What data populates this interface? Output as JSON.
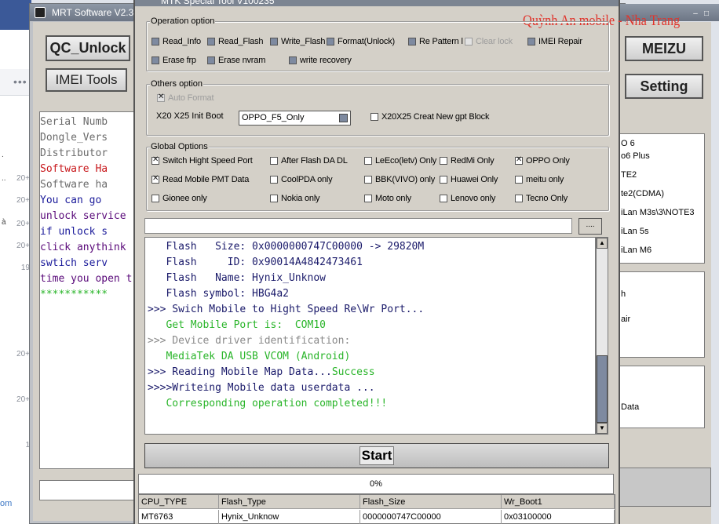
{
  "bg": {
    "gutter_numbers": [
      "20+",
      "20+",
      "20+",
      "20+",
      "19",
      "20+",
      "20+",
      "1"
    ],
    "gutter_chars": [
      ".",
      "..",
      "à"
    ],
    "bottom_link": "om"
  },
  "mrt": {
    "title": "MRT Software V2.3",
    "qc_unlock": "QC_Unlock",
    "imei_tools": "IMEI Tools",
    "meizu": "MEIZU",
    "setting": "Setting",
    "left_log": [
      {
        "text": "   Serial Numb",
        "color": "#6b6b6b"
      },
      {
        "text": "   Dongle_Vers",
        "color": "#6b6b6b"
      },
      {
        "text": "   Distributor",
        "color": "#6b6b6b"
      },
      {
        "text": "   Software Ha",
        "color": "#c8181c"
      },
      {
        "text": "   Software ha",
        "color": "#6b6b6b"
      },
      {
        "text": "   You can go",
        "color": "#1a1a9a"
      },
      {
        "text": "unlock service",
        "color": "#5a0a7a"
      },
      {
        "text": "   if unlock s",
        "color": "#1a1a9a"
      },
      {
        "text": "click anythink",
        "color": "#5a0a7a"
      },
      {
        "text": "   swtich serv",
        "color": "#1a1a9a"
      },
      {
        "text": "time you open t",
        "color": "#5a0a7a"
      },
      {
        "text": "   ***********",
        "color": "#2ab52a"
      }
    ],
    "right_list": [
      "O 6",
      "o6 Plus",
      "TE2",
      "te2(CDMA)",
      "iLan M3s\\3\\NOTE3",
      "iLan 5s",
      "iLan M6"
    ],
    "right_list2": [
      "h",
      "air"
    ],
    "right_list3": [
      "Data"
    ]
  },
  "dialog": {
    "title": "MTK Special Tool V100235",
    "watermark": "Quỳnh An mobile - Nha Trang",
    "operation_option": {
      "legend": "Operation option",
      "items": [
        {
          "label": "Read_Info",
          "checked": false,
          "disabled": false
        },
        {
          "label": "Read_Flash",
          "checked": false,
          "disabled": false
        },
        {
          "label": "Write_Flash",
          "checked": false,
          "disabled": false
        },
        {
          "label": "Format(Unlock)",
          "checked": false,
          "disabled": false
        },
        {
          "label": "Re Pattern l",
          "checked": false,
          "disabled": false
        },
        {
          "label": "Clear lock",
          "checked": false,
          "disabled": true
        },
        {
          "label": "IMEI Repair",
          "checked": false,
          "disabled": false
        },
        {
          "label": "Erase frp",
          "checked": false,
          "disabled": false
        },
        {
          "label": "Erase nvram",
          "checked": false,
          "disabled": false
        },
        {
          "label": "write recovery",
          "checked": false,
          "disabled": false
        }
      ]
    },
    "others_option": {
      "legend": "Others option",
      "auto_format": "Auto Format",
      "init_boot_label": "X20 X25 Init Boot",
      "init_boot_value": "OPPO_F5_Only",
      "gpt_block": "X20X25 Creat New gpt Block"
    },
    "global_options": {
      "legend": "Global Options",
      "items": [
        {
          "label": "Switch Hight Speed Port",
          "checked": true
        },
        {
          "label": "After Flash DA DL",
          "checked": false
        },
        {
          "label": "LeEco(letv) Only",
          "checked": false
        },
        {
          "label": "RedMi Only",
          "checked": false
        },
        {
          "label": "OPPO Only",
          "checked": true
        },
        {
          "label": "Read Mobile PMT Data",
          "checked": true
        },
        {
          "label": "CoolPDA only",
          "checked": false
        },
        {
          "label": "BBK(VIVO) only",
          "checked": false
        },
        {
          "label": "Huawei Only",
          "checked": false
        },
        {
          "label": "meitu only",
          "checked": false
        },
        {
          "label": "Gionee only",
          "checked": false
        },
        {
          "label": "Nokia only",
          "checked": false
        },
        {
          "label": "Moto only",
          "checked": false
        },
        {
          "label": "Lenovo only",
          "checked": false
        },
        {
          "label": "Tecno Only",
          "checked": false
        }
      ]
    },
    "path_value": "",
    "browse_label": "....",
    "log": [
      {
        "text": "   Flash   Size: 0x0000000747C00000 -> 29820M",
        "color": "#1a1a6a"
      },
      {
        "text": "   Flash     ID: 0x90014A4842473461",
        "color": "#1a1a6a"
      },
      {
        "text": "   Flash   Name: Hynix_Unknow",
        "color": "#1a1a6a"
      },
      {
        "text": "   Flash symbol: HBG4a2",
        "color": "#1a1a6a"
      },
      {
        "text": ">>> Swich Mobile to Hight Speed Re\\Wr Port...",
        "color": "#1a1a6a"
      },
      {
        "text": "   Get Mobile Port is:  COM10",
        "color": "#2ab52a"
      },
      {
        "text": ">>> Device driver identification:",
        "color": "#8a8a8a"
      },
      {
        "text": "   MediaTek DA USB VCOM (Android)",
        "color": "#2ab52a"
      },
      {
        "text": ">>> Reading Mobile Map Data...",
        "color": "#1a1a6a",
        "suffix": "Success",
        "suffix_color": "#2ab52a"
      },
      {
        "text": ">>>>Writeing Mobile data userdata ...",
        "color": "#1a1a6a"
      },
      {
        "text": "   Corresponding operation completed!!!",
        "color": "#2ab52a"
      }
    ],
    "start_label": "Start",
    "progress_text": "0%",
    "table": {
      "headers": [
        "CPU_TYPE",
        "Flash_Type",
        "Flash_Size",
        "Wr_Boot1"
      ],
      "row": [
        "MT6763",
        "Hynix_Unknow",
        "0000000747C00000",
        "0x03100000"
      ]
    }
  }
}
